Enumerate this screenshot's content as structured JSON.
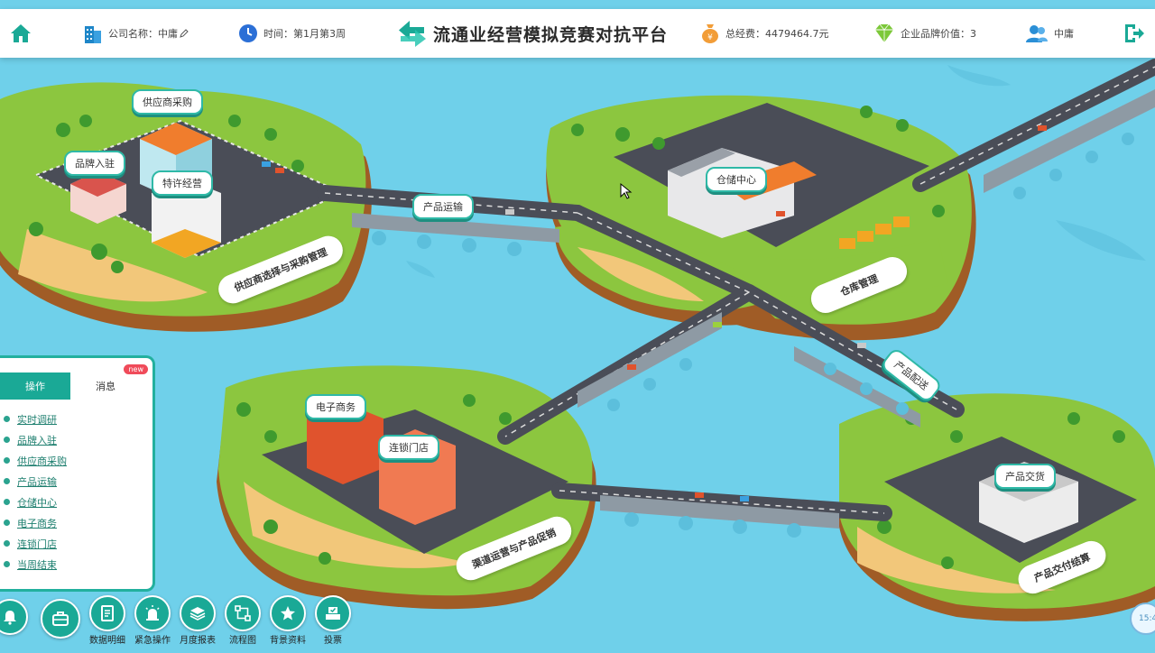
{
  "header": {
    "home_icon": "home-icon",
    "company_label": "公司名称：中庸",
    "company_icon": "building-icon",
    "time_label": "时间：第1月第3周",
    "time_icon": "clock-icon",
    "title": "流通业经营模拟竞赛对抗平台",
    "total_fee_label": "总经费：4479464.7元",
    "brand_value_label": "企业品牌价值：3",
    "user_name": "中庸",
    "logout_icon": "logout-icon"
  },
  "map": {
    "bubbles": {
      "supplier": "供应商采购",
      "brand_entry": "品牌入驻",
      "franchise": "特许经营",
      "transport": "产品运输",
      "warehouse": "仓储中心",
      "ecommerce": "电子商务",
      "chain_store": "连锁门店",
      "distribution": "产品配送",
      "delivery": "产品交货"
    },
    "banners": {
      "supplier_mgmt": "供应商选择与采购管理",
      "warehouse_mgmt": "仓库管理",
      "channel_mgmt": "渠道运营与产品促销",
      "delivery_mgmt": "产品交付结算"
    }
  },
  "panel": {
    "tab_ops": "操作",
    "tab_msg": "消息",
    "new_badge": "new",
    "items": [
      "实时调研",
      "品牌入驻",
      "供应商采购",
      "产品运输",
      "仓储中心",
      "电子商务",
      "连锁门店",
      "当周结束"
    ]
  },
  "toolbar": {
    "tools": [
      "数据明细",
      "紧急操作",
      "月度报表",
      "流程图",
      "背景资料",
      "投票"
    ]
  },
  "clock_badge": "15:4",
  "colors": {
    "teal": "#1aa996",
    "water": "#6fd0ea",
    "grass": "#8cc63f",
    "road": "#4a4d57"
  }
}
